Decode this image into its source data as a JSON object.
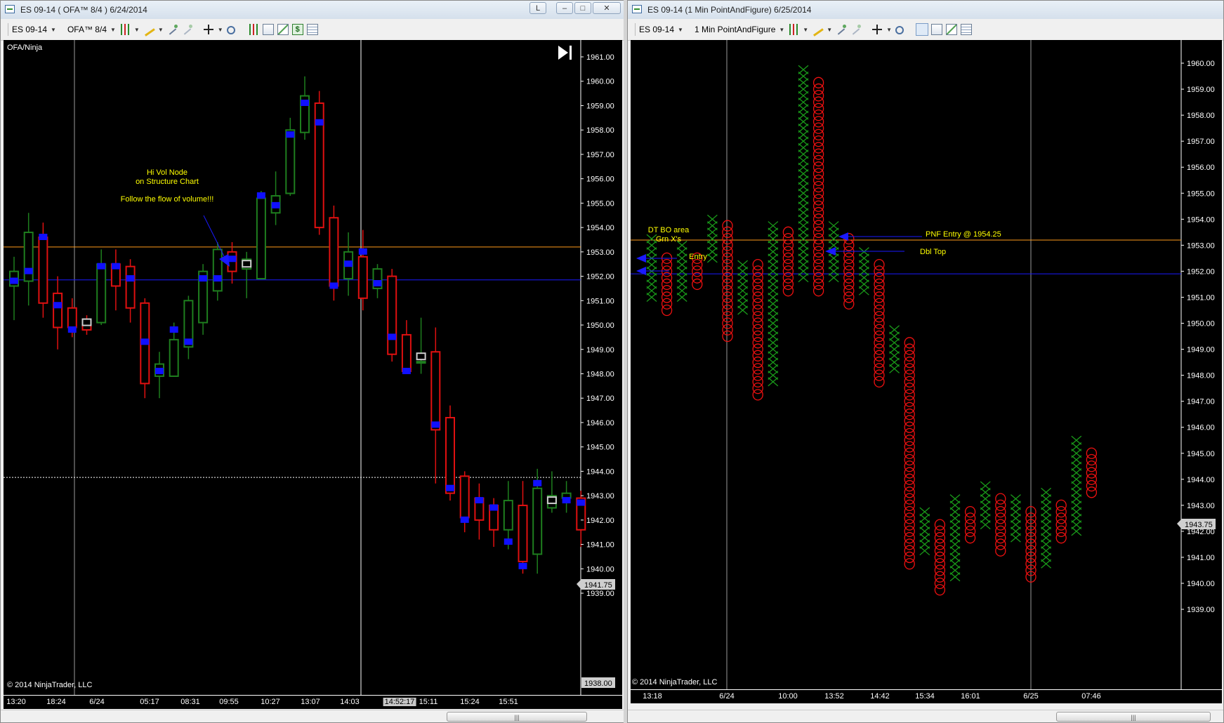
{
  "left_window": {
    "title": "ES 09-14 ( OFA™ 8/4 )  6/24/2014",
    "toolbar": {
      "instrument": "ES 09-14",
      "period": "OFA™ 8/4",
      "link_button": "L"
    },
    "chart_label": "OFA/Ninja",
    "copyright": "© 2014 NinjaTrader, LLC",
    "price_axis": [
      "1961.00",
      "1960.00",
      "1959.00",
      "1958.00",
      "1957.00",
      "1956.00",
      "1955.00",
      "1954.00",
      "1953.00",
      "1952.00",
      "1951.00",
      "1950.00",
      "1949.00",
      "1948.00",
      "1947.00",
      "1946.00",
      "1945.00",
      "1944.00",
      "1943.00",
      "1942.00",
      "1941.00",
      "1940.00",
      "1939.00"
    ],
    "last_price_marker": "1941.75",
    "low_marker": "1938.00",
    "time_axis": [
      "13:20",
      "18:24",
      "6/24",
      "05:17",
      "08:31",
      "09:55",
      "10:27",
      "13:07",
      "14:03",
      "14:52:17",
      "15:11",
      "15:24",
      "15:51"
    ],
    "crosshair_time": "14:52:17",
    "annotations": {
      "hi_vol_line1": "Hi Vol Node",
      "hi_vol_line2": "on Structure Chart",
      "follow_flow": "Follow the flow of volume!!!"
    },
    "colors": {
      "up": "#1e7e1e",
      "down": "#e01010",
      "vol_node": "#1010ff",
      "orange_line": "#ff9a1a",
      "blue_line": "#1a1aff",
      "annotation": "#ffff00"
    }
  },
  "right_window": {
    "title": "ES 09-14 (1 Min PointAndFigure)  6/25/2014",
    "toolbar": {
      "instrument": "ES 09-14",
      "period": "1 Min PointAndFigure"
    },
    "copyright": "© 2014 NinjaTrader, LLC",
    "price_axis": [
      "1960.00",
      "1959.00",
      "1958.00",
      "1957.00",
      "1956.00",
      "1955.00",
      "1954.00",
      "1953.00",
      "1952.00",
      "1951.00",
      "1950.00",
      "1949.00",
      "1948.00",
      "1947.00",
      "1946.00",
      "1945.00",
      "1944.00",
      "1943.00",
      "1942.00",
      "1941.00",
      "1940.00",
      "1939.00"
    ],
    "last_price_marker": "1943.75",
    "time_axis": [
      "13:18",
      "6/24",
      "10:00",
      "13:52",
      "14:42",
      "15:34",
      "16:01",
      "6/25",
      "07:46"
    ],
    "annotations": {
      "dt_bo_line1": "DT BO area",
      "dt_bo_line2": "Grn X's",
      "entry": "Entry",
      "pnf_entry": "PNF Entry @ 1954.25",
      "dbl_top": "Dbl Top"
    }
  },
  "chart_data": [
    {
      "type": "candlestick",
      "title": "OFA/Ninja",
      "ylim": [
        1938.5,
        1962.0
      ],
      "orange_level": 1953.2,
      "blue_level": 1951.85,
      "dotted_level": 1943.75,
      "candles": [
        {
          "o": 1951.6,
          "c": 1952.2,
          "h": 1952.8,
          "l": 1950.2,
          "v": 1951.8
        },
        {
          "o": 1951.8,
          "c": 1953.8,
          "h": 1954.6,
          "l": 1950.8,
          "v": 1952.2
        },
        {
          "o": 1953.6,
          "c": 1950.9,
          "h": 1954.2,
          "l": 1950.3,
          "v": 1953.6
        },
        {
          "o": 1951.3,
          "c": 1949.9,
          "h": 1952.0,
          "l": 1949.0,
          "v": 1950.8
        },
        {
          "o": 1950.7,
          "c": 1949.9,
          "h": 1951.1,
          "l": 1949.5,
          "v": 1949.8
        },
        {
          "o": 1950.2,
          "c": 1949.8,
          "h": 1950.4,
          "l": 1949.6,
          "v": 1950.1
        },
        {
          "o": 1950.1,
          "c": 1952.5,
          "h": 1953.1,
          "l": 1950.0,
          "v": 1952.4
        },
        {
          "o": 1952.5,
          "c": 1951.6,
          "h": 1953.1,
          "l": 1950.6,
          "v": 1952.4
        },
        {
          "o": 1952.4,
          "c": 1950.7,
          "h": 1952.7,
          "l": 1950.1,
          "v": 1951.9
        },
        {
          "o": 1950.9,
          "c": 1947.6,
          "h": 1951.1,
          "l": 1947.0,
          "v": 1949.3
        },
        {
          "o": 1947.9,
          "c": 1948.4,
          "h": 1948.9,
          "l": 1947.0,
          "v": 1948.1
        },
        {
          "o": 1947.9,
          "c": 1949.4,
          "h": 1950.1,
          "l": 1947.9,
          "v": 1949.8
        },
        {
          "o": 1949.1,
          "c": 1951.0,
          "h": 1951.2,
          "l": 1948.6,
          "v": 1949.3
        },
        {
          "o": 1950.1,
          "c": 1952.2,
          "h": 1952.5,
          "l": 1949.6,
          "v": 1951.9
        },
        {
          "o": 1951.4,
          "c": 1953.1,
          "h": 1953.4,
          "l": 1951.0,
          "v": 1951.9
        },
        {
          "o": 1953.0,
          "c": 1952.2,
          "h": 1953.4,
          "l": 1951.7,
          "v": 1952.7
        },
        {
          "o": 1952.3,
          "c": 1952.7,
          "h": 1953.0,
          "l": 1951.1,
          "v": 1952.5
        },
        {
          "o": 1951.9,
          "c": 1955.2,
          "h": 1955.5,
          "l": 1951.9,
          "v": 1955.3
        },
        {
          "o": 1954.6,
          "c": 1955.3,
          "h": 1956.3,
          "l": 1954.1,
          "v": 1954.9
        },
        {
          "o": 1955.4,
          "c": 1958.0,
          "h": 1958.5,
          "l": 1955.3,
          "v": 1957.8
        },
        {
          "o": 1957.9,
          "c": 1959.4,
          "h": 1960.2,
          "l": 1957.6,
          "v": 1959.1
        },
        {
          "o": 1959.1,
          "c": 1954.0,
          "h": 1959.6,
          "l": 1953.7,
          "v": 1958.3
        },
        {
          "o": 1954.4,
          "c": 1951.6,
          "h": 1954.9,
          "l": 1951.0,
          "v": 1951.6
        },
        {
          "o": 1951.9,
          "c": 1953.0,
          "h": 1953.8,
          "l": 1951.2,
          "v": 1952.5
        },
        {
          "o": 1952.8,
          "c": 1951.1,
          "h": 1953.9,
          "l": 1950.6,
          "v": 1953.0
        },
        {
          "o": 1951.5,
          "c": 1952.3,
          "h": 1952.5,
          "l": 1951.1,
          "v": 1951.7
        },
        {
          "o": 1952.0,
          "c": 1948.8,
          "h": 1952.3,
          "l": 1948.5,
          "v": 1949.5
        },
        {
          "o": 1949.6,
          "c": 1948.1,
          "h": 1950.2,
          "l": 1948.0,
          "v": 1948.1
        },
        {
          "o": 1948.5,
          "c": 1948.5,
          "h": 1950.3,
          "l": 1948.0,
          "v": 1948.7
        },
        {
          "o": 1948.9,
          "c": 1945.7,
          "h": 1949.9,
          "l": 1943.5,
          "v": 1945.9
        },
        {
          "o": 1946.2,
          "c": 1943.1,
          "h": 1946.7,
          "l": 1942.8,
          "v": 1943.3
        },
        {
          "o": 1943.8,
          "c": 1942.1,
          "h": 1944.0,
          "l": 1941.5,
          "v": 1942.0
        },
        {
          "o": 1942.9,
          "c": 1942.0,
          "h": 1943.5,
          "l": 1941.2,
          "v": 1942.8
        },
        {
          "o": 1942.6,
          "c": 1941.6,
          "h": 1942.9,
          "l": 1940.9,
          "v": 1942.5
        },
        {
          "o": 1941.6,
          "c": 1942.8,
          "h": 1943.6,
          "l": 1940.8,
          "v": 1941.1
        },
        {
          "o": 1942.6,
          "c": 1940.3,
          "h": 1943.6,
          "l": 1939.8,
          "v": 1940.1
        },
        {
          "o": 1940.6,
          "c": 1943.3,
          "h": 1944.1,
          "l": 1939.8,
          "v": 1943.5
        },
        {
          "o": 1942.5,
          "c": 1943.0,
          "h": 1944.0,
          "l": 1942.3,
          "v": 1942.8
        },
        {
          "o": 1942.9,
          "c": 1943.1,
          "h": 1943.6,
          "l": 1942.3,
          "v": 1942.8
        },
        {
          "o": 1942.9,
          "c": 1941.6,
          "h": 1943.2,
          "l": 1940.9,
          "v": 1942.7
        }
      ],
      "neutral_markers": [
        5,
        16,
        28,
        37
      ]
    },
    {
      "type": "point-and-figure",
      "box_size": 0.25,
      "ylim": [
        1938.5,
        1960.6
      ],
      "orange_level": 1953.2,
      "blue_level": 1951.9,
      "columns": [
        {
          "t": "X",
          "lo": 1951.0,
          "hi": 1953.25
        },
        {
          "t": "O",
          "lo": 1950.5,
          "hi": 1952.5
        },
        {
          "t": "X",
          "lo": 1951.0,
          "hi": 1953.0
        },
        {
          "t": "O",
          "lo": 1951.5,
          "hi": 1952.5
        },
        {
          "t": "X",
          "lo": 1952.5,
          "hi": 1954.0
        },
        {
          "t": "O",
          "lo": 1949.5,
          "hi": 1953.75
        },
        {
          "t": "X",
          "lo": 1950.5,
          "hi": 1952.25
        },
        {
          "t": "O",
          "lo": 1947.25,
          "hi": 1952.25
        },
        {
          "t": "X",
          "lo": 1947.75,
          "hi": 1953.75
        },
        {
          "t": "O",
          "lo": 1951.25,
          "hi": 1953.5
        },
        {
          "t": "X",
          "lo": 1951.75,
          "hi": 1959.75
        },
        {
          "t": "O",
          "lo": 1951.25,
          "hi": 1959.25
        },
        {
          "t": "X",
          "lo": 1951.75,
          "hi": 1953.75
        },
        {
          "t": "O",
          "lo": 1950.75,
          "hi": 1953.25
        },
        {
          "t": "X",
          "lo": 1951.25,
          "hi": 1952.75
        },
        {
          "t": "O",
          "lo": 1947.75,
          "hi": 1952.25
        },
        {
          "t": "X",
          "lo": 1948.25,
          "hi": 1949.75
        },
        {
          "t": "O",
          "lo": 1940.75,
          "hi": 1949.25
        },
        {
          "t": "X",
          "lo": 1941.25,
          "hi": 1942.75
        },
        {
          "t": "O",
          "lo": 1939.75,
          "hi": 1942.25
        },
        {
          "t": "X",
          "lo": 1940.25,
          "hi": 1943.25
        },
        {
          "t": "O",
          "lo": 1941.75,
          "hi": 1942.75
        },
        {
          "t": "X",
          "lo": 1942.25,
          "hi": 1943.75
        },
        {
          "t": "O",
          "lo": 1941.25,
          "hi": 1943.25
        },
        {
          "t": "X",
          "lo": 1941.75,
          "hi": 1943.25
        },
        {
          "t": "O",
          "lo": 1940.25,
          "hi": 1942.75
        },
        {
          "t": "X",
          "lo": 1940.75,
          "hi": 1943.5
        },
        {
          "t": "O",
          "lo": 1941.75,
          "hi": 1943.0
        },
        {
          "t": "X",
          "lo": 1942.0,
          "hi": 1945.5
        },
        {
          "t": "O",
          "lo": 1943.5,
          "hi": 1945.0
        }
      ]
    }
  ]
}
